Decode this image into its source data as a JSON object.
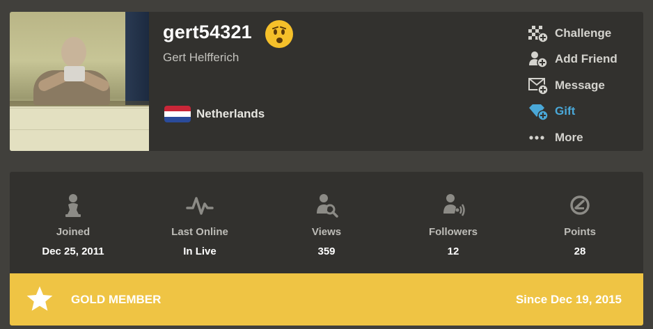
{
  "profile": {
    "username": "gert54321",
    "real_name": "Gert Helfferich",
    "country": "Netherlands",
    "mood_icon": "worried-face-icon"
  },
  "actions": [
    {
      "label": "Challenge",
      "icon": "challenge-icon"
    },
    {
      "label": "Add Friend",
      "icon": "add-friend-icon"
    },
    {
      "label": "Message",
      "icon": "message-icon"
    },
    {
      "label": "Gift",
      "icon": "gift-icon",
      "color": "#4aa8d8"
    },
    {
      "label": "More",
      "icon": "more-icon"
    }
  ],
  "stats": [
    {
      "label": "Joined",
      "value": "Dec 25, 2011",
      "icon": "pawn-icon"
    },
    {
      "label": "Last Online",
      "value": "In Live",
      "icon": "activity-icon"
    },
    {
      "label": "Views",
      "value": "359",
      "icon": "views-icon"
    },
    {
      "label": "Followers",
      "value": "12",
      "icon": "followers-icon"
    },
    {
      "label": "Points",
      "value": "28",
      "icon": "points-icon"
    }
  ],
  "membership": {
    "title": "GOLD MEMBER",
    "since": "Since Dec 19, 2015",
    "color": "#efc444"
  },
  "colors": {
    "background": "#41403c",
    "card": "#32312e",
    "gift": "#4aa8d8",
    "gold": "#efc444"
  }
}
